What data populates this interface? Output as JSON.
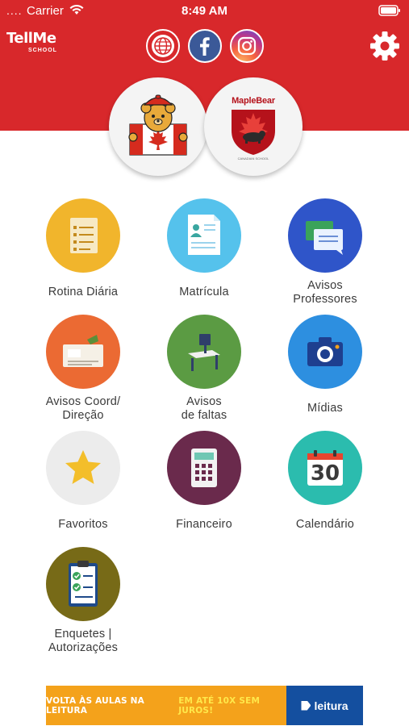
{
  "status_bar": {
    "dots": "....",
    "carrier": "Carrier",
    "time": "8:49 AM"
  },
  "logo": {
    "main": "TellMe",
    "sub": "SCHOOL"
  },
  "school_logos": {
    "maple_text": "MapleBear",
    "maple_subtext": "CANADIAN SCHOOL"
  },
  "menu": {
    "rotina": "Rotina Diária",
    "matricula": "Matrícula",
    "avisos_prof_1": "Avisos",
    "avisos_prof_2": "Professores",
    "avisos_coord_1": "Avisos Coord/",
    "avisos_coord_2": "Direção",
    "avisos_faltas_1": "Avisos",
    "avisos_faltas_2": "de faltas",
    "midias": "Mídias",
    "favoritos": "Favoritos",
    "financeiro": "Financeiro",
    "calendario": "Calendário",
    "calendario_day": "30",
    "enquetes_1": "Enquetes |",
    "enquetes_2": "Autorizações"
  },
  "banner": {
    "text": "VOLTA ÀS AULAS NA LEITURA",
    "highlight": "EM ATÉ 10X SEM JUROS!",
    "brand": "leitura"
  },
  "colors": {
    "header": "#d8282b",
    "rotina": "#f1b52c",
    "matricula": "#55c2ec",
    "avisos_prof": "#2f55c9",
    "avisos_coord": "#eb6a33",
    "avisos_faltas": "#5b9b43",
    "midias": "#2d8fe0",
    "favoritos": "#ececec",
    "financeiro": "#6a2a4c",
    "calendario": "#2bbcae",
    "enquetes": "#776a17"
  },
  "icons": {
    "globe": "globe-icon",
    "facebook": "facebook-icon",
    "instagram": "instagram-icon",
    "settings": "gear-icon"
  }
}
